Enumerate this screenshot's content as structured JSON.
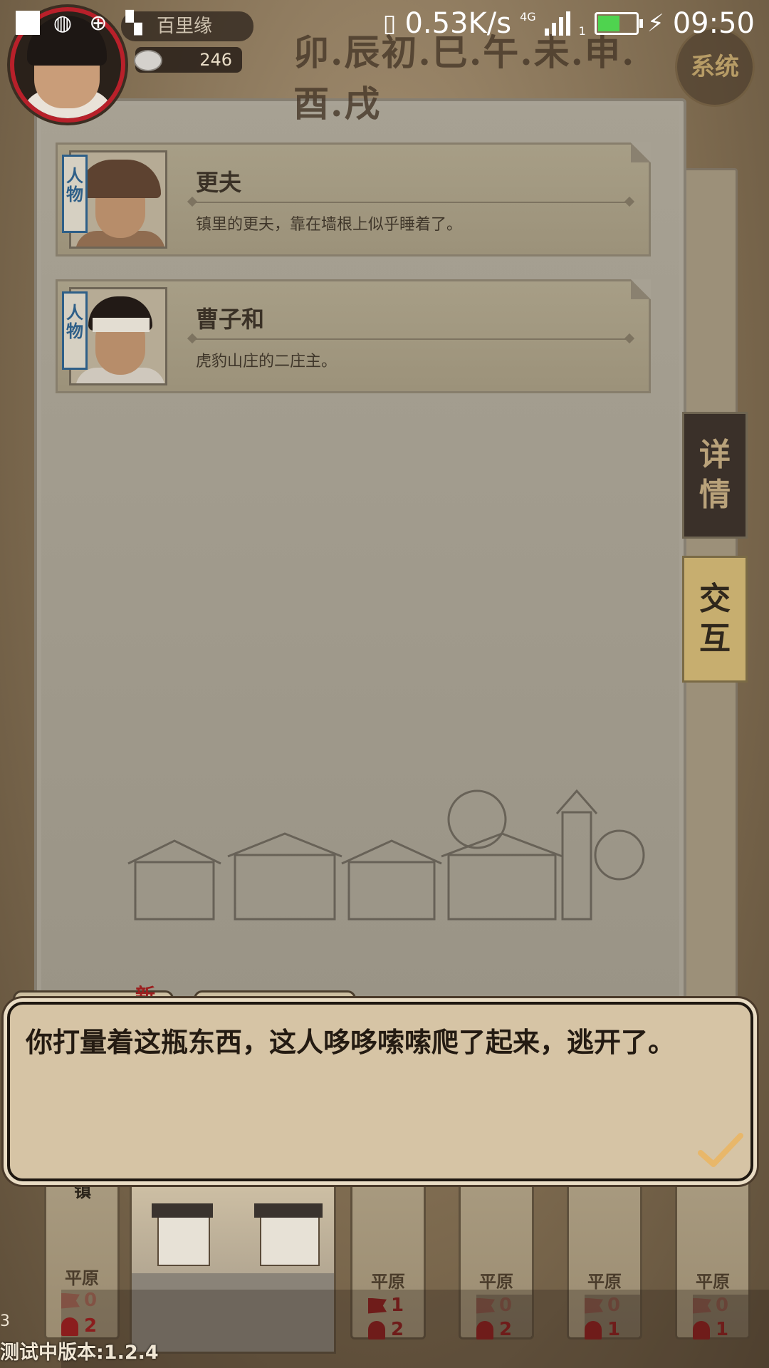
{
  "status_bar": {
    "speed": "0.53K/s",
    "network": "4G",
    "sim": "1",
    "time": "09:50",
    "icons": [
      "square-notification-icon",
      "globe-icon",
      "app-icon",
      "dots-app-icon",
      "vibrate-icon",
      "signal-icon",
      "battery-icon",
      "charging-icon"
    ]
  },
  "hud": {
    "player_name": "百里缘",
    "silver": "246",
    "time_periods": "卯.辰初.巳.午.未.申.酉.戌",
    "system_button": "系统"
  },
  "entries": [
    {
      "tag": "人物",
      "name": "更夫",
      "description": "镇里的更夫，靠在墙根上似乎睡着了。"
    },
    {
      "tag": "人物",
      "name": "曹子和",
      "description": "虎豹山庄的二庄主。"
    }
  ],
  "side_tabs": {
    "detail": "详情",
    "interact": "交互"
  },
  "behind_tabs": {
    "new_badge": "新"
  },
  "dialog": {
    "message": "你打量着这瓶东西，这人哆哆嗦嗦爬了起来，逃开了。"
  },
  "map": {
    "town_label": "镇",
    "cards": [
      {
        "terrain": "平原",
        "flags": "0",
        "people": "2"
      },
      {
        "terrain": "平原",
        "flags": "1",
        "people": "2"
      },
      {
        "terrain": "平原",
        "flags": "0",
        "people": "2"
      },
      {
        "terrain": "平原",
        "flags": "0",
        "people": "1"
      },
      {
        "terrain": "平原",
        "flags": "0",
        "people": "1"
      }
    ]
  },
  "version": "测试中版本:1.2.4",
  "left_partial_number": "3"
}
